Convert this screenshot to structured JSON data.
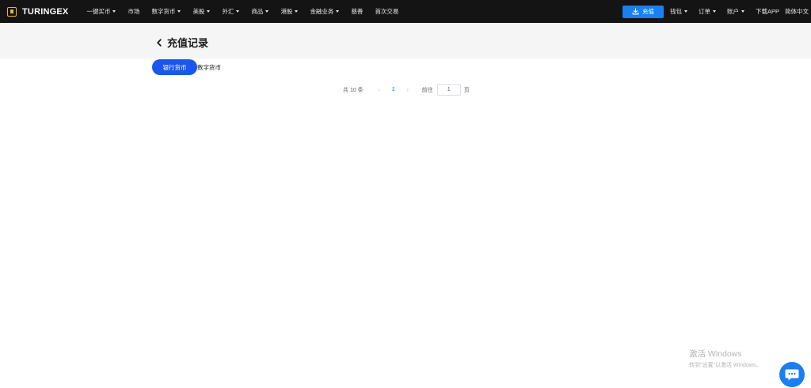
{
  "header": {
    "logo_text": "TURINGEX",
    "nav": [
      {
        "label": "一键买币",
        "dropdown": true
      },
      {
        "label": "市场",
        "dropdown": false
      },
      {
        "label": "数字货币",
        "dropdown": true
      },
      {
        "label": "美股",
        "dropdown": true
      },
      {
        "label": "外汇",
        "dropdown": true
      },
      {
        "label": "商品",
        "dropdown": true
      },
      {
        "label": "港股",
        "dropdown": true
      },
      {
        "label": "金融业务",
        "dropdown": true
      },
      {
        "label": "慈善",
        "dropdown": false
      },
      {
        "label": "首次交易",
        "dropdown": false
      }
    ],
    "deposit_label": "充值",
    "right_nav": [
      {
        "label": "钱包",
        "dropdown": true
      },
      {
        "label": "订单",
        "dropdown": true
      },
      {
        "label": "账户",
        "dropdown": true
      },
      {
        "label": "下载APP",
        "dropdown": false
      },
      {
        "label": "简体中文",
        "dropdown": false
      }
    ]
  },
  "page": {
    "title": "充值记录",
    "tabs": [
      "银行货币",
      "数字货币"
    ],
    "active_tab": 0
  },
  "pagination": {
    "total_text": "共 10 条",
    "prev": "‹",
    "current": "1",
    "next": "›",
    "goto_label": "前往",
    "goto_value": "1",
    "page_unit": "页"
  },
  "windows_watermark": {
    "line1": "激活 Windows",
    "line2": "转到\"设置\"以激活 Windows。"
  },
  "icons": {
    "deposit": "download-icon",
    "back": "chevron-left-icon",
    "chat": "chat-bubble-icon"
  },
  "colors": {
    "topbar": "#141414",
    "primary": "#1a7ff0",
    "tab_active": "#1a56f0",
    "pager_active": "#409eff",
    "logo_accent": "#f0b90b"
  }
}
